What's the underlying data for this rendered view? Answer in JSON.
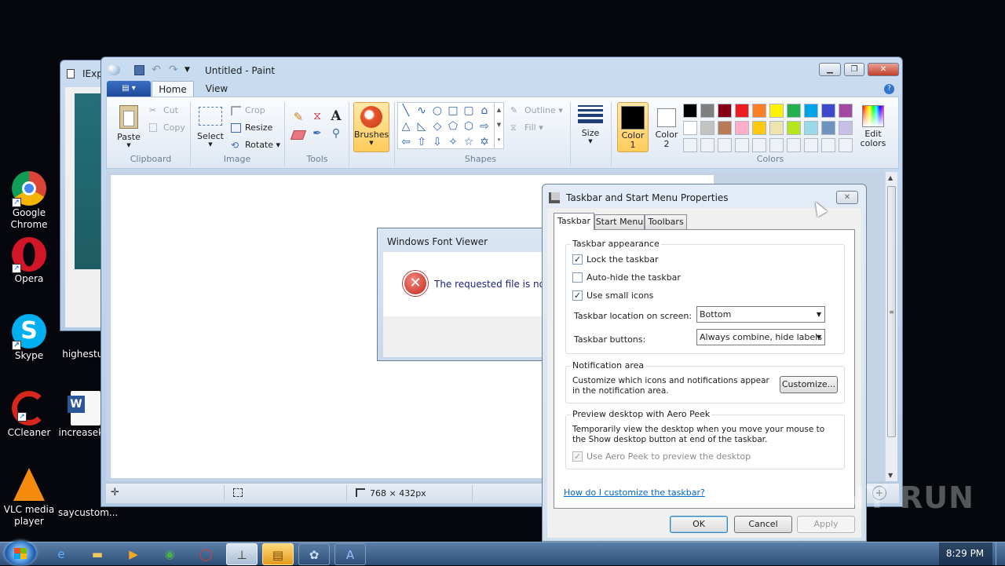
{
  "desktop": {
    "icons": [
      {
        "label": "Google Chrome",
        "icon": "chrome-icon"
      },
      {
        "label": "Opera",
        "icon": "opera-icon"
      },
      {
        "label": "Skype",
        "icon": "skype-icon"
      },
      {
        "label": "highestu...",
        "icon": "file-icon"
      },
      {
        "label": "CCleaner",
        "icon": "ccleaner-icon"
      },
      {
        "label": "increasek...",
        "icon": "word-icon"
      },
      {
        "label": "VLC media player",
        "icon": "vlc-icon"
      },
      {
        "label": "saycustom...",
        "icon": "file-icon"
      }
    ]
  },
  "iexp_window": {
    "title": "IExp"
  },
  "paint": {
    "title": "Untitled - Paint",
    "tabs": [
      "Home",
      "View"
    ],
    "clipboard": {
      "paste": "Paste",
      "cut": "Cut",
      "copy": "Copy",
      "label": "Clipboard"
    },
    "image": {
      "select": "Select",
      "crop": "Crop",
      "resize": "Resize",
      "rotate": "Rotate",
      "label": "Image"
    },
    "tools": {
      "label": "Tools"
    },
    "brushes": "Brushes",
    "shapes": {
      "label": "Shapes",
      "outline": "Outline",
      "fill": "Fill"
    },
    "size": "Size",
    "color1": {
      "line1": "Color",
      "line2": "1"
    },
    "color2": {
      "line1": "Color",
      "line2": "2"
    },
    "colors_label": "Colors",
    "edit_colors": {
      "line1": "Edit",
      "line2": "colors"
    },
    "status_dims": "768 × 432px",
    "palette": [
      "#000000",
      "#7f7f7f",
      "#880015",
      "#ed1c24",
      "#ff7f27",
      "#fff200",
      "#22b14c",
      "#00a2e8",
      "#3f48cc",
      "#a349a4",
      "#ffffff",
      "#c3c3c3",
      "#b97a57",
      "#ffaec9",
      "#ffc90e",
      "#efe4b0",
      "#b5e61d",
      "#99d9ea",
      "#7092be",
      "#c8bfe7"
    ]
  },
  "font_viewer": {
    "title": "Windows Font Viewer",
    "message": "The requested file  is not a"
  },
  "taskbar_props": {
    "title": "Taskbar and Start Menu Properties",
    "tabs": [
      "Taskbar",
      "Start Menu",
      "Toolbars"
    ],
    "appearance": {
      "legend": "Taskbar appearance",
      "lock": "Lock the taskbar",
      "autohide": "Auto-hide the taskbar",
      "small_icons": "Use small icons",
      "location_label": "Taskbar location on screen:",
      "location_value": "Bottom",
      "buttons_label": "Taskbar buttons:",
      "buttons_value": "Always combine, hide labels"
    },
    "notification": {
      "legend": "Notification area",
      "text": "Customize which icons and notifications appear in the notification area.",
      "customize": "Customize..."
    },
    "peek": {
      "legend": "Preview desktop with Aero Peek",
      "text": "Temporarily view the desktop when you move your mouse to the Show desktop button at end of the taskbar.",
      "checkbox": "Use Aero Peek to preview the desktop"
    },
    "help_link": "How do I customize the taskbar?",
    "ok": "OK",
    "cancel": "Cancel",
    "apply": "Apply"
  },
  "watermark": "ANY RUN",
  "taskbar": {
    "clock": "8:29 PM"
  }
}
